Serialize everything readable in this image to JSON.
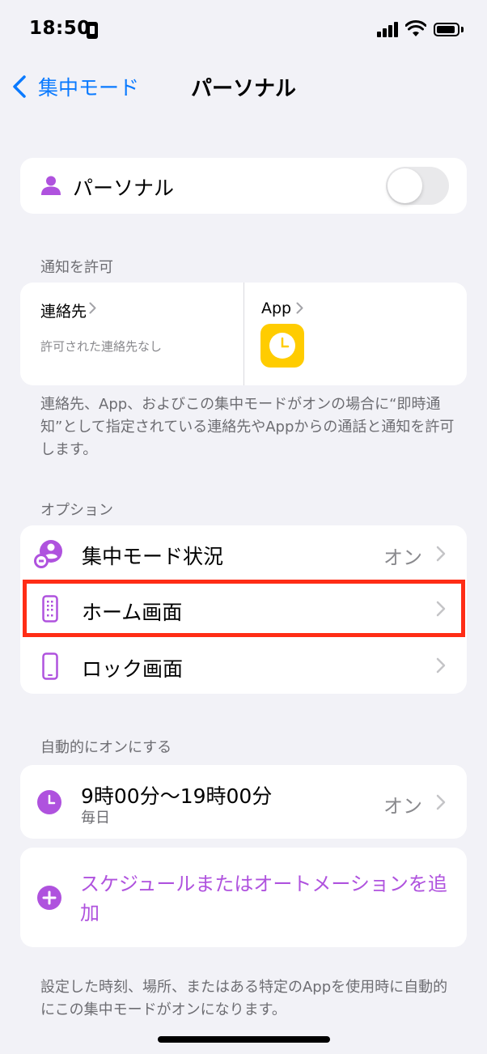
{
  "status_bar": {
    "time": "18:50"
  },
  "nav": {
    "back_label": "集中モード",
    "title": "パーソナル"
  },
  "focus_toggle": {
    "label": "パーソナル",
    "enabled": false
  },
  "allowed_notifications": {
    "header": "通知を許可",
    "contacts": {
      "title": "連絡先",
      "subtitle": "許可された連絡先なし"
    },
    "apps": {
      "title": "App"
    },
    "footnote": "連絡先、App、およびこの集中モードがオンの場合に“即時通知”として指定されている連絡先やAppからの通話と通知を許可します。"
  },
  "options": {
    "header": "オプション",
    "items": [
      {
        "label": "集中モード状況",
        "value": "オン"
      },
      {
        "label": "ホーム画面",
        "value": ""
      },
      {
        "label": "ロック画面",
        "value": ""
      }
    ]
  },
  "auto_on": {
    "header": "自動的にオンにする",
    "schedule": {
      "title": "9時00分〜19時00分",
      "subtitle": "毎日",
      "value": "オン"
    },
    "add_label": "スケジュールまたはオートメーションを追加",
    "footnote": "設定した時刻、場所、またはある特定のAppを使用時に自動的にこの集中モードがオンになります。"
  },
  "colors": {
    "accent_purple": "#af52de",
    "ios_blue": "#0a7aff",
    "highlight_red": "#ff2d16",
    "app_yellow": "#ffcc00"
  }
}
